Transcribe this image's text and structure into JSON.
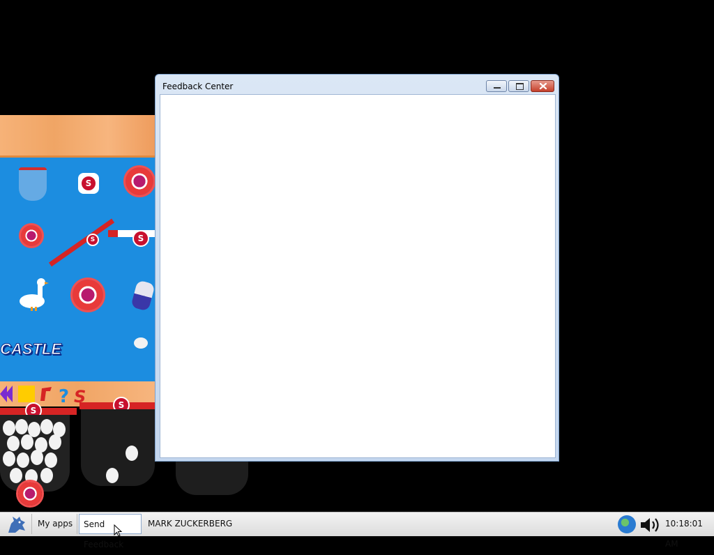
{
  "window": {
    "title": "Feedback Center"
  },
  "taskbar": {
    "items": [
      {
        "label": "My apps"
      },
      {
        "label": "Send Feedback"
      },
      {
        "label": "MARK ZUCKERBERG"
      }
    ],
    "clock": "10:18:01 AM"
  },
  "game": {
    "sign_text": "CASTLE",
    "badge_letter": "S"
  },
  "colors": {
    "board": "#1c8de0",
    "wood": "#f0a565",
    "window_frame": "#c3d6ee",
    "close_button": "#c5402b"
  }
}
